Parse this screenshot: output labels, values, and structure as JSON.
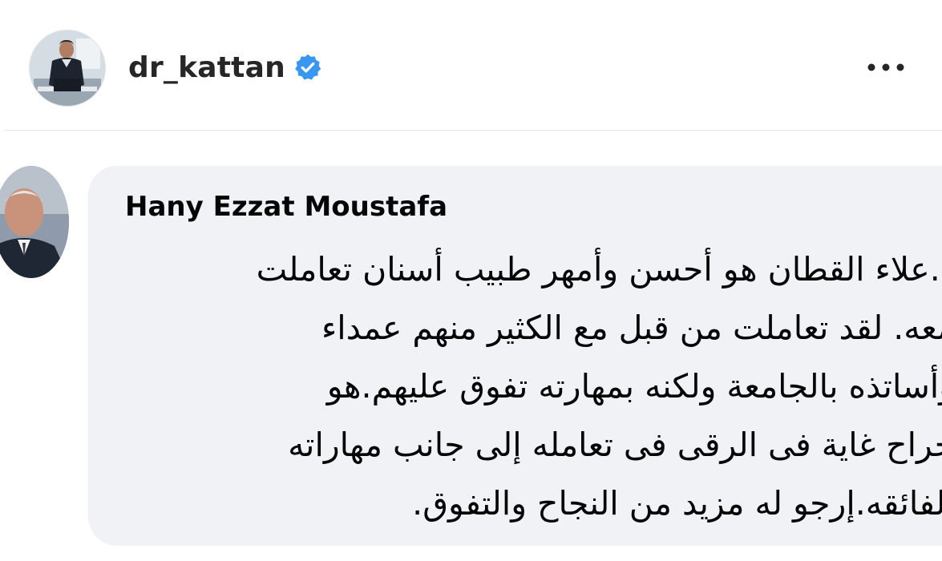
{
  "post": {
    "username": "dr_kattan",
    "verified": true,
    "more_label": "•••"
  },
  "comment": {
    "author": "Hany Ezzat Moustafa",
    "lines": [
      "د.علاء القطان هو أحسن وأمهر طبيب أسنان تعاملت",
      "معه. لقد تعاملت من قبل مع الكثير منهم عمداء",
      "وأساتذه بالجامعة ولكنه بمهارته تفوق عليهم.هو",
      "جراح غاية فى الرقى فى تعامله إلى جانب مهاراته",
      "الفائقه.إرجو له مزيد من النجاح والتفوق."
    ]
  },
  "colors": {
    "verified_badge": "#3897f0",
    "bubble_bg": "#f0f2f5",
    "text": "#050505",
    "username": "#262626",
    "divider": "#e4e6eb"
  },
  "icons": {
    "verified": "verified-badge-icon",
    "more": "more-options-icon"
  }
}
